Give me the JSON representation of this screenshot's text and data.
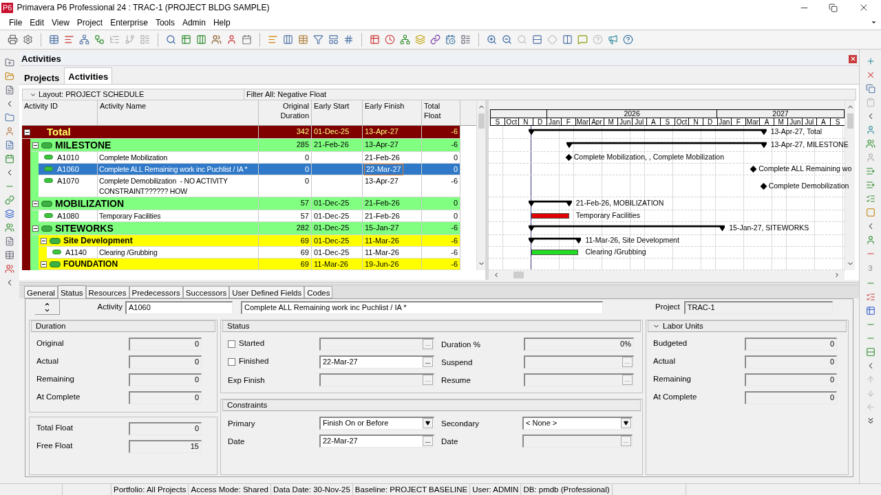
{
  "window": {
    "app_badge": "P6",
    "title": "Primavera P6 Professional 24 : TRAC-1 (PROJECT BLDG SAMPLE)"
  },
  "menu": [
    "File",
    "Edit",
    "View",
    "Project",
    "Enterprise",
    "Tools",
    "Admin",
    "Help"
  ],
  "right_toolbar_count": "3",
  "panel": {
    "title": "Activities",
    "tabs": [
      {
        "label": "Projects",
        "selected": false
      },
      {
        "label": "Activities",
        "selected": true
      }
    ]
  },
  "layout_bar": {
    "layout": "Layout: PROJECT SCHEDULE",
    "filter": "Filter All: Negative Float"
  },
  "table": {
    "columns": [
      "Activity ID",
      "Activity Name",
      "Original Duration",
      "Early Start",
      "Early Finish",
      "Total Float"
    ],
    "rows": [
      {
        "kind": "total",
        "name": "Total",
        "expanded": true,
        "selected": false,
        "duration": "342",
        "start": "01-Dec-25",
        "finish": "13-Apr-27",
        "float": "-6",
        "bar": {
          "kind": "summary",
          "label": "13-Apr-27, Total"
        },
        "children": [
          {
            "kind": "wbs1",
            "name": "MILESTONE",
            "expanded": true,
            "selected": false,
            "duration": "285",
            "start": "21-Feb-26",
            "finish": "13-Apr-27",
            "float": "-6",
            "bar": {
              "kind": "summary",
              "label": "13-Apr-27, MILESTONE"
            },
            "children": [
              {
                "kind": "activity",
                "id": "A1010",
                "name": "Complete Mobilization",
                "selected": false,
                "duration": "0",
                "finish": "21-Feb-26",
                "float": "0",
                "bar": {
                  "kind": "milestone",
                  "label": "Complete Mobilization, , Complete Mobilization"
                }
              },
              {
                "kind": "activity",
                "id": "A1060",
                "name": "Complete ALL Remaining work inc Puchlist / IA *",
                "selected": true,
                "duration": "0",
                "finish": "22-Mar-27",
                "float": "0",
                "bar": {
                  "kind": "milestone",
                  "label": "Complete ALL Remaining wo"
                }
              },
              {
                "kind": "activity",
                "id": "A1070",
                "name": "Complete Demobilization  - NO ACTIVITY CONSTRAINT?????? HOW",
                "selected": false,
                "duration": "0",
                "finish": "13-Apr-27",
                "float": "-6",
                "bar": {
                  "kind": "milestone",
                  "label": "Complete Demobilization"
                }
              }
            ]
          },
          {
            "kind": "wbs1",
            "name": "MOBILIZATION",
            "expanded": true,
            "selected": false,
            "duration": "57",
            "start": "01-Dec-25",
            "finish": "21-Feb-26",
            "float": "0",
            "bar": {
              "kind": "summary",
              "label": "21-Feb-26, MOBILIZATION"
            },
            "children": [
              {
                "kind": "activity",
                "id": "A1080",
                "name": "Temporary Facilities",
                "selected": false,
                "duration": "57",
                "start": "01-Dec-25",
                "finish": "21-Feb-26",
                "float": "0",
                "bar": {
                  "kind": "task",
                  "color": "#e00000",
                  "label": "Temporary Facilities"
                }
              }
            ]
          },
          {
            "kind": "wbs1",
            "name": "SITEWORKS",
            "expanded": true,
            "selected": false,
            "duration": "282",
            "start": "01-Dec-25",
            "finish": "15-Jan-27",
            "float": "-6",
            "bar": {
              "kind": "summary",
              "label": "15-Jan-27, SITEWORKS"
            },
            "children": [
              {
                "kind": "wbs2",
                "name": "Site Development",
                "expanded": true,
                "selected": false,
                "duration": "69",
                "start": "01-Dec-25",
                "finish": "11-Mar-26",
                "float": "-6",
                "bar": {
                  "kind": "summary",
                  "label": "11-Mar-26, Site Development"
                },
                "children": [
                  {
                    "kind": "activity",
                    "id": "A1140",
                    "name": "Clearing /Grubbing",
                    "selected": false,
                    "duration": "69",
                    "start": "01-Dec-25",
                    "finish": "11-Mar-26",
                    "float": "-6",
                    "bar": {
                      "kind": "task",
                      "color": "#22dd22",
                      "label": "Clearing /Grubbing"
                    }
                  }
                ]
              },
              {
                "kind": "wbs2",
                "name": "FOUNDATION",
                "expanded": true,
                "selected": false,
                "duration": "69",
                "start": "11-Mar-26",
                "finish": "19-Jun-26",
                "float": "-6"
              }
            ]
          }
        ]
      }
    ]
  },
  "gantt": {
    "months": [
      "S",
      "Oct",
      "N",
      "D",
      "Jan",
      "F",
      "Mar",
      "Apr",
      "M",
      "Jun",
      "Jul",
      "A",
      "S",
      "Oct",
      "N",
      "D",
      "Jan",
      "F",
      "Mar",
      "A",
      "M",
      "Jun",
      "Jul",
      "A",
      "S"
    ],
    "years": [
      "2026",
      "2027"
    ]
  },
  "details": {
    "tabs": [
      {
        "label": "General",
        "selected": false
      },
      {
        "label": "Status",
        "selected": true
      },
      {
        "label": "Resources",
        "selected": false
      },
      {
        "label": "Predecessors",
        "selected": false
      },
      {
        "label": "Successors",
        "selected": false
      },
      {
        "label": "User Defined Fields",
        "selected": false
      },
      {
        "label": "Codes",
        "selected": false
      }
    ],
    "activity": {
      "label": "Activity",
      "id": "A1060",
      "name": "Complete ALL Remaining work inc Puchlist / IA *"
    },
    "project": {
      "label": "Project",
      "value": "TRAC-1"
    },
    "duration": {
      "title": "Duration",
      "fields": [
        {
          "label": "Original",
          "value": "0"
        },
        {
          "label": "Actual",
          "value": "0"
        },
        {
          "label": "Remaining",
          "value": "0"
        },
        {
          "label": "At Complete",
          "value": "0"
        }
      ]
    },
    "floats": {
      "fields": [
        {
          "label": "Total Float",
          "value": "0"
        },
        {
          "label": "Free Float",
          "value": "15"
        }
      ]
    },
    "status": {
      "title": "Status",
      "left": [
        {
          "kind": "check",
          "label": "Started",
          "checked": false,
          "disabled": true
        },
        {
          "kind": "check",
          "label": "Finished",
          "checked": false,
          "value": "22-Mar-27",
          "disabled": false
        },
        {
          "kind": "date",
          "label": "Exp Finish",
          "disabled": true
        }
      ],
      "right": [
        {
          "kind": "number",
          "label": "Duration %",
          "value": "0%",
          "disabled": true
        },
        {
          "kind": "date",
          "label": "Suspend",
          "disabled": true
        },
        {
          "kind": "date",
          "label": "Resume",
          "disabled": true
        }
      ]
    },
    "constraints": {
      "title": "Constraints",
      "left": [
        {
          "kind": "select",
          "label": "Primary",
          "value": "Finish On or Before",
          "disabled": false
        },
        {
          "kind": "date",
          "label": "Date",
          "value": "22-Mar-27",
          "disabled": false
        }
      ],
      "right": [
        {
          "kind": "select",
          "label": "Secondary",
          "value": "< None >",
          "disabled": false
        },
        {
          "kind": "date",
          "label": "Date",
          "disabled": true
        }
      ]
    },
    "labor_units": {
      "title": "Labor Units",
      "expanded": true,
      "fields": [
        {
          "label": "Budgeted",
          "value": "0"
        },
        {
          "label": "Actual",
          "value": "0"
        },
        {
          "label": "Remaining",
          "value": "0"
        },
        {
          "label": "At Complete",
          "value": "0"
        }
      ]
    }
  },
  "status_bar": [
    "Portfolio: All Projects",
    "Access Mode: Shared",
    "Data Date: 30-Nov-25",
    "Baseline: PROJECT BASELINE",
    "User: ADMIN",
    "DB: pmdb (Professional)"
  ]
}
